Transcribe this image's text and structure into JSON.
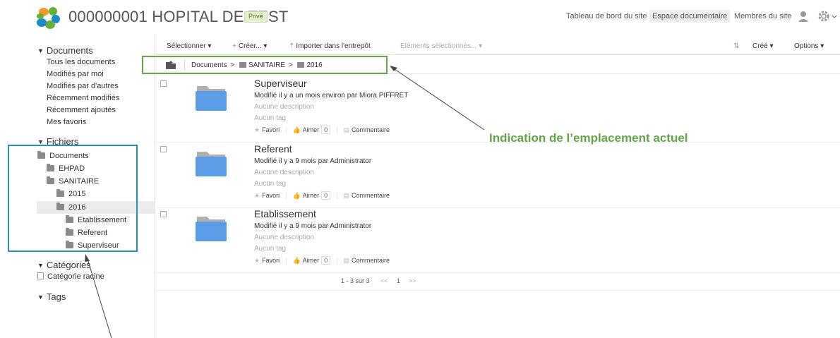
{
  "header": {
    "site_title": "000000001 HOPITAL DE TEST",
    "badge": "Privé",
    "nav": [
      "Tableau de bord du site",
      "Espace documentaire",
      "Membres du site"
    ],
    "active_nav": "Espace documentaire",
    "icons": [
      "user-icon",
      "gear-icon"
    ]
  },
  "sidebar": {
    "documents_title": "Documents",
    "documents_links": [
      "Tous les documents",
      "Modifiés par moi",
      "Modifiés par d'autres",
      "Récemment modifiés",
      "Récemment ajoutés",
      "Mes favoris"
    ],
    "fichiers_title": "Fichiers",
    "tree": [
      {
        "label": "Documents",
        "level": 0
      },
      {
        "label": "EHPAD",
        "level": 1
      },
      {
        "label": "SANITAIRE",
        "level": 1
      },
      {
        "label": "2015",
        "level": 2
      },
      {
        "label": "2016",
        "level": 2,
        "selected": true
      },
      {
        "label": "Etablissement",
        "level": 3
      },
      {
        "label": "Referent",
        "level": 3
      },
      {
        "label": "Superviseur",
        "level": 3
      }
    ],
    "categories_title": "Catégories",
    "categories_item": "Catégorie racine",
    "tags_title": "Tags"
  },
  "toolbar": {
    "select": "Sélectionner ▾",
    "create": "Créer... ▾",
    "import": "Importer dans l'entrepôt",
    "selected_items": "Eléments sélectionnés... ▾",
    "sort": "Créé ▾",
    "options": "Options ▾"
  },
  "breadcrumb": {
    "root": "Documents",
    "separator": ">",
    "folder1": "SANITAIRE",
    "folder2": "2016"
  },
  "documents": [
    {
      "title": "Superviseur",
      "modified": "Modifié il y a un mois environ par Miora PIFFRET",
      "description": "Aucune description",
      "tags": "Aucun tag",
      "favori": "Favori",
      "aimer": "Aimer",
      "likes": "0",
      "comment": "Commentaire"
    },
    {
      "title": "Referent",
      "modified": "Modifié il y a 9 mois par Administrator",
      "description": "Aucune description",
      "tags": "Aucun tag",
      "favori": "Favori",
      "aimer": "Aimer",
      "likes": "0",
      "comment": "Commentaire"
    },
    {
      "title": "Etablissement",
      "modified": "Modifié il y a 9 mois par Administrator",
      "description": "Aucune description",
      "tags": "Aucun tag",
      "favori": "Favori",
      "aimer": "Aimer",
      "likes": "0",
      "comment": "Commentaire"
    }
  ],
  "pagination": {
    "range": "1 - 3 sur 3",
    "prev": "<<",
    "page": "1",
    "next": ">>"
  },
  "annotation": {
    "label": "Indication de l’emplacement actuel",
    "color_breadcrumb_box": "#62a546",
    "color_tree_box": "#1f93c0"
  }
}
